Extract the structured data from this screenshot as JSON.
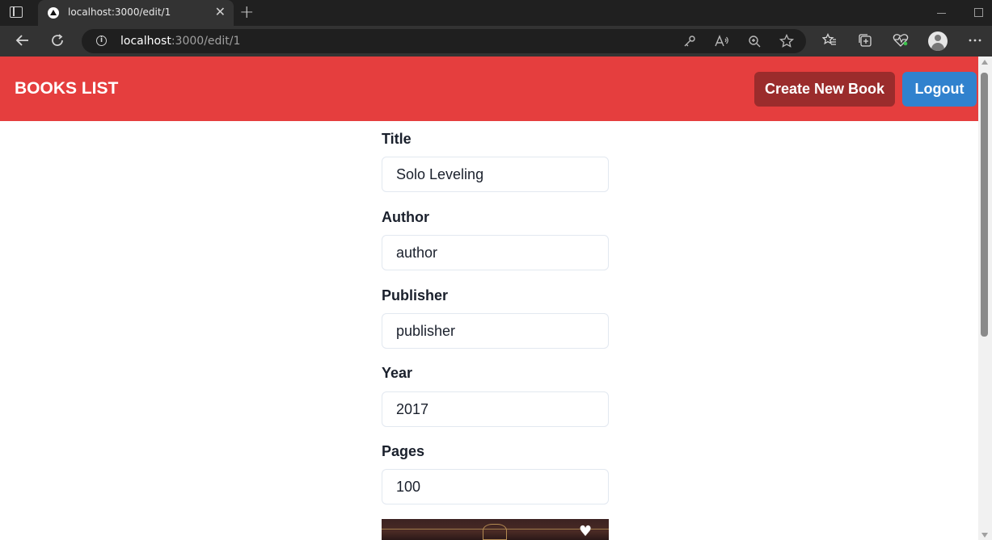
{
  "browser": {
    "tab_title": "localhost:3000/edit/1",
    "tab_close": "✕",
    "new_tab": "+",
    "url_host": "localhost",
    "url_path": ":3000/edit/1",
    "icons": [
      "tab-actions-icon",
      "back-icon",
      "refresh-icon",
      "info-icon",
      "key-icon",
      "read-aloud-icon",
      "zoom-icon",
      "favorite-star-icon",
      "favorites-icon",
      "collections-icon",
      "health-icon",
      "profile-avatar",
      "more-icon"
    ]
  },
  "navbar": {
    "brand": "BOOKS LIST",
    "create_label": "Create New Book",
    "logout_label": "Logout",
    "colors": {
      "bg": "#e53e3e",
      "create": "#9b2c2c",
      "logout": "#3182ce"
    }
  },
  "form": {
    "fields": [
      {
        "label": "Title",
        "value": "Solo Leveling"
      },
      {
        "label": "Author",
        "value": "author"
      },
      {
        "label": "Publisher",
        "value": "publisher"
      },
      {
        "label": "Year",
        "value": "2017"
      },
      {
        "label": "Pages",
        "value": "100"
      }
    ]
  },
  "cover_image": {
    "heart": "♥"
  }
}
